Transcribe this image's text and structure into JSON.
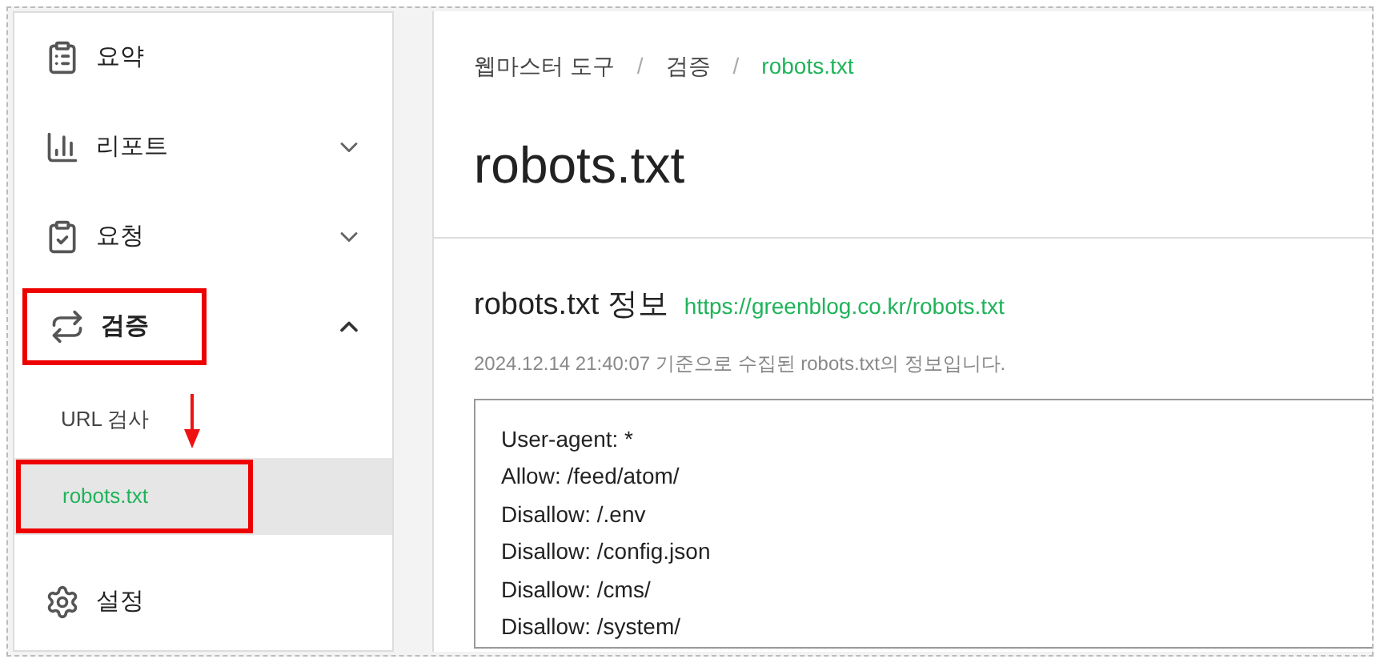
{
  "sidebar": {
    "items": [
      {
        "label": "요약",
        "highlighted": false
      },
      {
        "label": "리포트",
        "expanded": false,
        "highlighted": false
      },
      {
        "label": "요청",
        "expanded": false,
        "highlighted": false
      },
      {
        "label": "검증",
        "expanded": true,
        "highlighted": true,
        "children": [
          {
            "label": "URL 검사",
            "selected": false,
            "highlighted": false
          },
          {
            "label": "robots.txt",
            "selected": true,
            "highlighted": true
          }
        ]
      },
      {
        "label": "설정",
        "highlighted": false
      }
    ]
  },
  "breadcrumb": [
    {
      "label": "웹마스터 도구",
      "current": false
    },
    {
      "label": "검증",
      "current": false
    },
    {
      "label": "robots.txt",
      "current": true
    }
  ],
  "breadcrumb_separator": "/",
  "title": "robots.txt",
  "section": {
    "heading": "robots.txt 정보",
    "link": "https://greenblog.co.kr/robots.txt",
    "caption": "2024.12.14 21:40:07 기준으로 수집된 robots.txt의 정보입니다.",
    "lines": [
      "User-agent: *",
      "Allow: /feed/atom/",
      "Disallow: /.env",
      "Disallow: /config.json",
      "Disallow: /cms/",
      "Disallow: /system/"
    ]
  }
}
